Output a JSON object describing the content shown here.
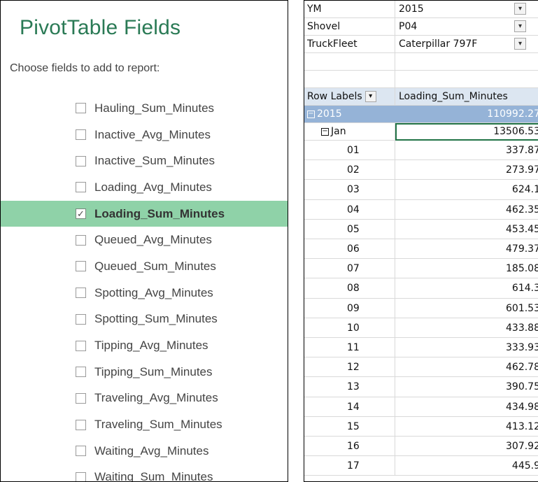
{
  "fields_panel": {
    "title": "PivotTable Fields",
    "subtitle": "Choose fields to add to report:",
    "fields": [
      {
        "label": "Hauling_Sum_Minutes",
        "checked": false
      },
      {
        "label": "Inactive_Avg_Minutes",
        "checked": false
      },
      {
        "label": "Inactive_Sum_Minutes",
        "checked": false
      },
      {
        "label": "Loading_Avg_Minutes",
        "checked": false
      },
      {
        "label": "Loading_Sum_Minutes",
        "checked": true
      },
      {
        "label": "Queued_Avg_Minutes",
        "checked": false
      },
      {
        "label": "Queued_Sum_Minutes",
        "checked": false
      },
      {
        "label": "Spotting_Avg_Minutes",
        "checked": false
      },
      {
        "label": "Spotting_Sum_Minutes",
        "checked": false
      },
      {
        "label": "Tipping_Avg_Minutes",
        "checked": false
      },
      {
        "label": "Tipping_Sum_Minutes",
        "checked": false
      },
      {
        "label": "Traveling_Avg_Minutes",
        "checked": false
      },
      {
        "label": "Traveling_Sum_Minutes",
        "checked": false
      },
      {
        "label": "Waiting_Avg_Minutes",
        "checked": false
      },
      {
        "label": "Waiting_Sum_Minutes",
        "checked": false
      }
    ],
    "accent_color": "#2a7a55",
    "checked_row_color": "#8fd2a8",
    "check_glyph": "✓"
  },
  "pivot": {
    "filters": [
      {
        "label": "YM",
        "value": "2015"
      },
      {
        "label": "Shovel",
        "value": "P04"
      },
      {
        "label": "TruckFleet",
        "value": "Caterpillar 797F"
      }
    ],
    "filter_icon": "filter-dropdown-icon",
    "header": {
      "row_labels": "Row Labels",
      "value_field": "Loading_Sum_Minutes"
    },
    "year": {
      "label": "2015",
      "value": "110992.27"
    },
    "month": {
      "label": "Jan",
      "value": "13506.53"
    },
    "days": [
      {
        "label": "01",
        "value": "337.87"
      },
      {
        "label": "02",
        "value": "273.97"
      },
      {
        "label": "03",
        "value": "624.1"
      },
      {
        "label": "04",
        "value": "462.35"
      },
      {
        "label": "05",
        "value": "453.45"
      },
      {
        "label": "06",
        "value": "479.37"
      },
      {
        "label": "07",
        "value": "185.08"
      },
      {
        "label": "08",
        "value": "614.3"
      },
      {
        "label": "09",
        "value": "601.53"
      },
      {
        "label": "10",
        "value": "433.88"
      },
      {
        "label": "11",
        "value": "333.93"
      },
      {
        "label": "12",
        "value": "462.78"
      },
      {
        "label": "13",
        "value": "390.75"
      },
      {
        "label": "14",
        "value": "434.98"
      },
      {
        "label": "15",
        "value": "413.12"
      },
      {
        "label": "16",
        "value": "307.92"
      },
      {
        "label": "17",
        "value": "445.9"
      }
    ],
    "colors": {
      "header_bg": "#dce6f1",
      "year_bg": "#95b3d7",
      "selection_border": "#217346"
    }
  }
}
